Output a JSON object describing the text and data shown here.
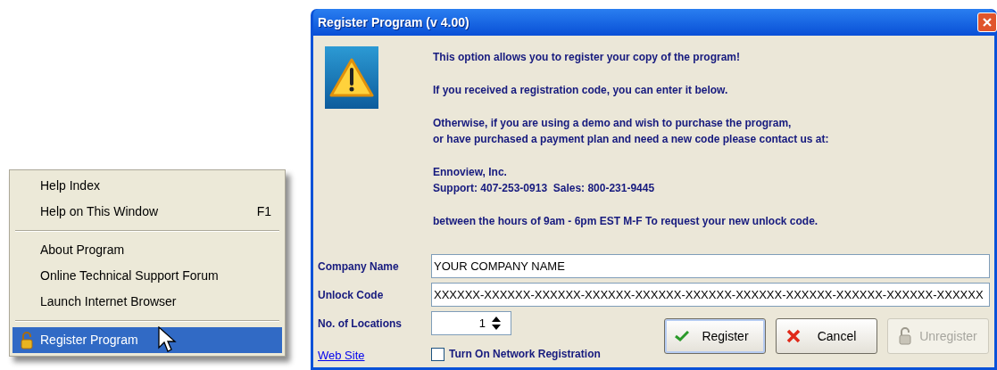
{
  "context_menu": {
    "sections": [
      {
        "items": [
          {
            "label": "Help Index",
            "selected": false
          },
          {
            "label": "Help on This Window",
            "shortcut": "F1",
            "selected": false
          }
        ]
      },
      {
        "items": [
          {
            "label": "About Program",
            "selected": false
          },
          {
            "label": "Online Technical Support Forum",
            "selected": false
          },
          {
            "label": "Launch Internet Browser",
            "selected": false
          }
        ]
      },
      {
        "items": [
          {
            "label": "Register Program",
            "selected": true,
            "kind": "lock"
          }
        ]
      }
    ]
  },
  "dialog": {
    "title": "Register Program (v 4.00)",
    "message": [
      [
        "This option allows you to register your copy of the program!"
      ],
      [
        "If you received a registration code, you can enter it below."
      ],
      [
        "Otherwise, if you are using a demo and wish to purchase the program,",
        "or have purchased a payment plan and need a new code please contact us at:"
      ],
      [
        "Ennoview, Inc.",
        "Support: 407-253-0913  Sales: 800-231-9445"
      ],
      [
        "between the hours of 9am - 6pm EST M-F To request your new unlock code."
      ]
    ],
    "fields": [
      {
        "label": "Company Name",
        "kind": "text",
        "value": "YOUR COMPANY NAME"
      },
      {
        "label": "Unlock Code",
        "kind": "text",
        "value": "XXXXXX-XXXXXX-XXXXXX-XXXXXX-XXXXXX-XXXXXX-XXXXXX-XXXXXX-XXXXXX-XXXXXX-XXXXXX"
      },
      {
        "label": "No. of Locations",
        "kind": "spinner",
        "value": "1"
      }
    ],
    "link": "Web Site",
    "checkbox": {
      "label": "Turn On Network Registration",
      "checked": false
    },
    "buttons": [
      {
        "label": "Register",
        "kind": "check",
        "disabled": false,
        "selected": true
      },
      {
        "label": "Cancel",
        "kind": "cross",
        "disabled": false,
        "selected": false
      },
      {
        "label": "Unregister",
        "kind": "lock",
        "disabled": true,
        "selected": false
      }
    ]
  }
}
